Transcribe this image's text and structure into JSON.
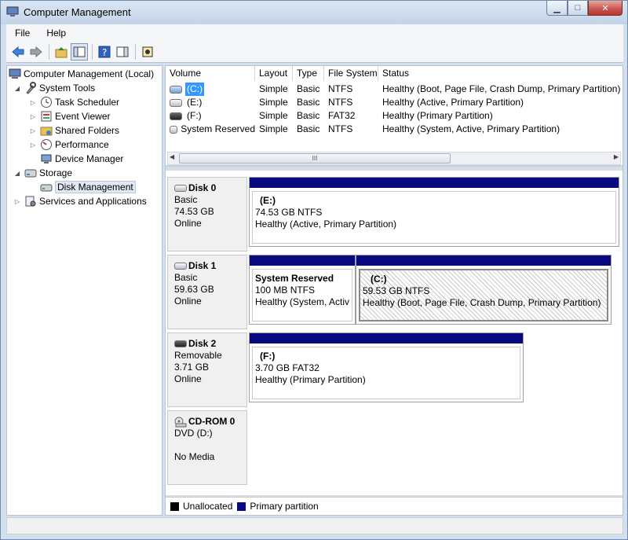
{
  "window": {
    "title": "Computer Management"
  },
  "menu": {
    "file": "File",
    "help": "Help"
  },
  "tree": {
    "root": "Computer Management (Local)",
    "system_tools": "System Tools",
    "task_scheduler": "Task Scheduler",
    "event_viewer": "Event Viewer",
    "shared_folders": "Shared Folders",
    "performance": "Performance",
    "device_manager": "Device Manager",
    "storage": "Storage",
    "disk_management": "Disk Management",
    "services": "Services and Applications"
  },
  "volumes": {
    "columns": [
      "Volume",
      "Layout",
      "Type",
      "File System",
      "Status"
    ],
    "rows": [
      {
        "volume": "(C:)",
        "layout": "Simple",
        "type": "Basic",
        "fs": "NTFS",
        "status": "Healthy (Boot, Page File, Crash Dump, Primary Partition)"
      },
      {
        "volume": "(E:)",
        "layout": "Simple",
        "type": "Basic",
        "fs": "NTFS",
        "status": "Healthy (Active, Primary Partition)"
      },
      {
        "volume": "(F:)",
        "layout": "Simple",
        "type": "Basic",
        "fs": "FAT32",
        "status": "Healthy (Primary Partition)"
      },
      {
        "volume": "System Reserved",
        "layout": "Simple",
        "type": "Basic",
        "fs": "NTFS",
        "status": "Healthy (System, Active, Primary Partition)"
      }
    ],
    "scroll_grip": "III"
  },
  "disks": {
    "disk0": {
      "name": "Disk 0",
      "type": "Basic",
      "size": "74.53 GB",
      "state": "Online",
      "p1": {
        "name": "(E:)",
        "size": "74.53 GB NTFS",
        "status": "Healthy (Active, Primary Partition)"
      }
    },
    "disk1": {
      "name": "Disk 1",
      "type": "Basic",
      "size": "59.63 GB",
      "state": "Online",
      "p1": {
        "name": "System Reserved",
        "size": "100 MB NTFS",
        "status": "Healthy (System, Activ"
      },
      "p2": {
        "name": "(C:)",
        "size": "59.53 GB NTFS",
        "status": "Healthy (Boot, Page File, Crash Dump, Primary Partition)"
      }
    },
    "disk2": {
      "name": "Disk 2",
      "type": "Removable",
      "size": "3.71 GB",
      "state": "Online",
      "p1": {
        "name": "(F:)",
        "size": "3.70 GB FAT32",
        "status": "Healthy (Primary Partition)"
      }
    },
    "cdrom0": {
      "name": "CD-ROM 0",
      "type": "DVD (D:)",
      "state": "No Media"
    }
  },
  "legend": {
    "unallocated": "Unallocated",
    "primary": "Primary partition",
    "unallocated_color": "#000000",
    "primary_color": "#0a0a80"
  }
}
